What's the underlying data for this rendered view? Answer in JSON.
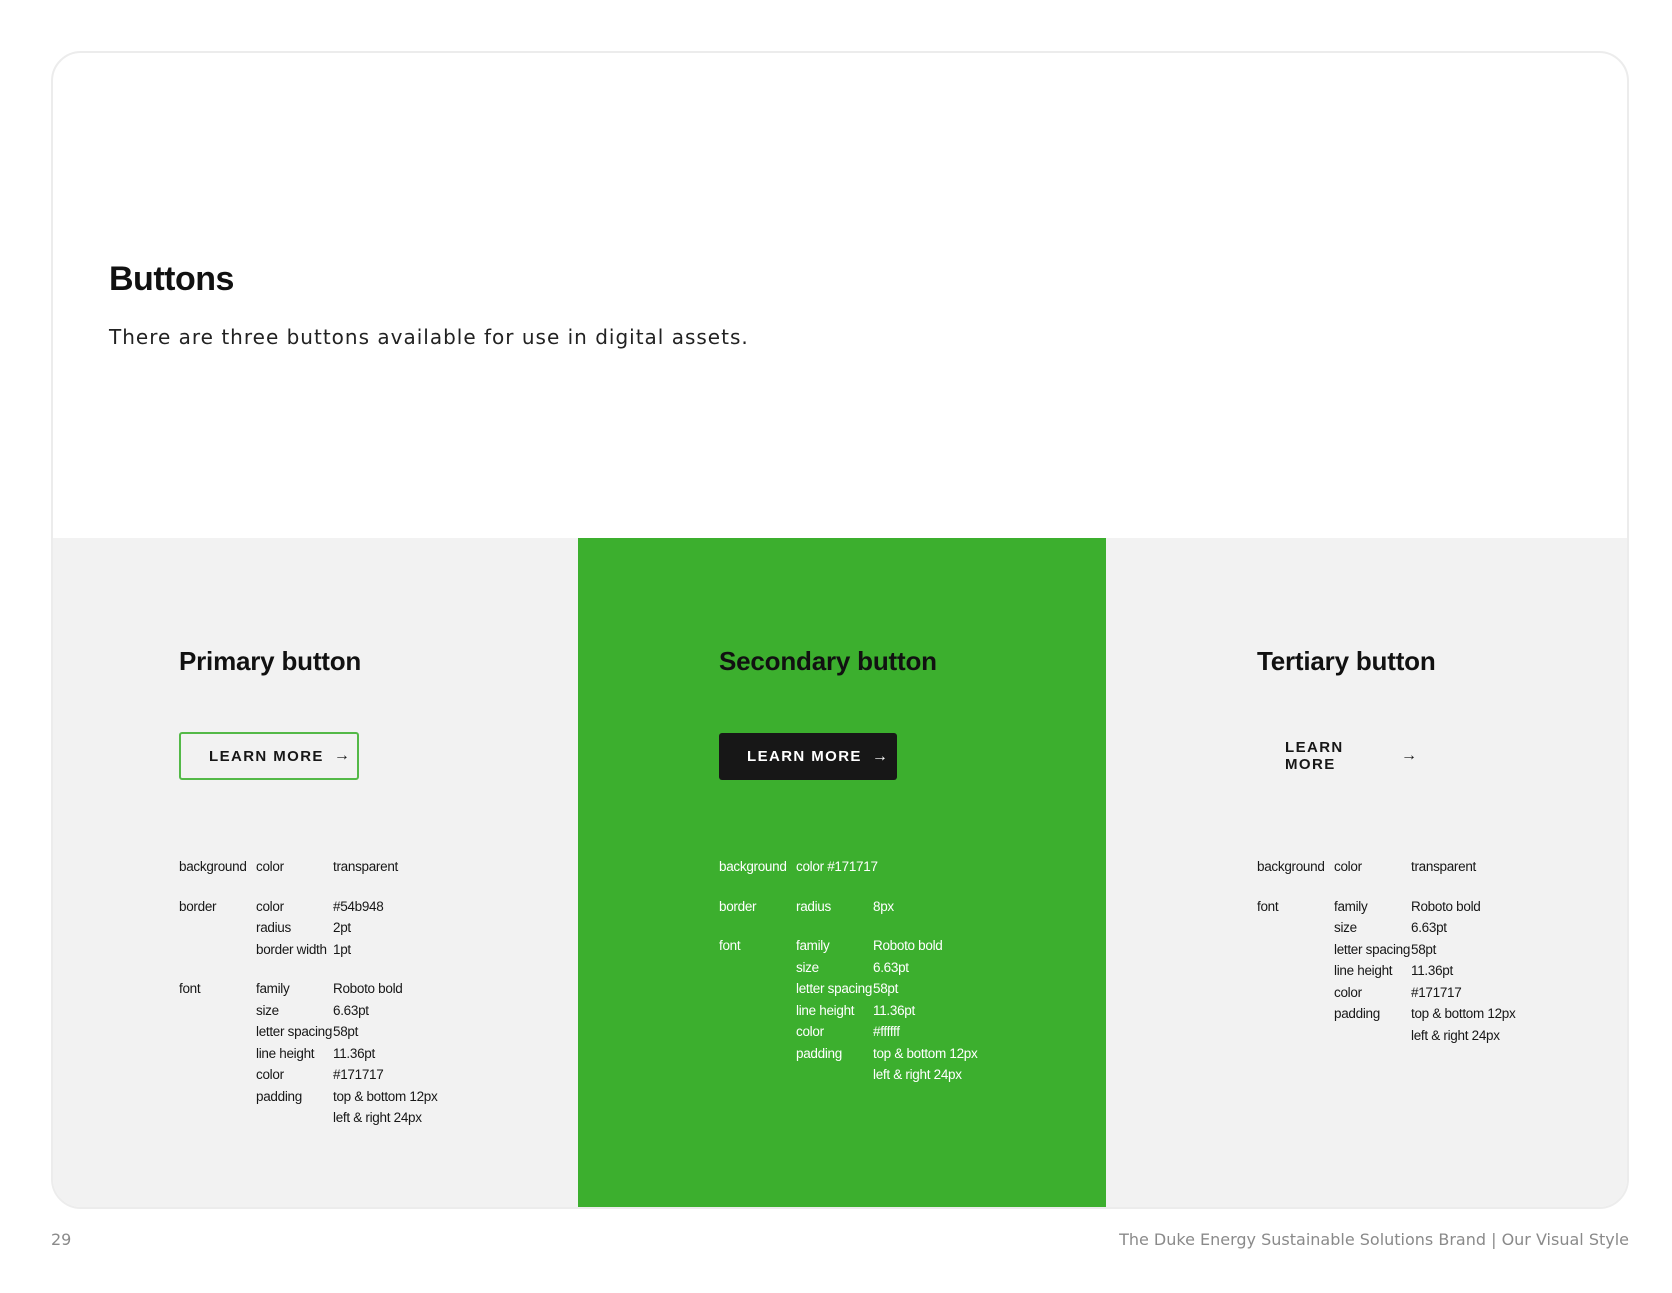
{
  "intro": {
    "title": "Buttons",
    "description": "There are three buttons available for use in digital assets."
  },
  "panels": {
    "primary": {
      "title": "Primary button",
      "button_label": "LEARN MORE",
      "specs": [
        {
          "category": "background",
          "rows": [
            {
              "k": "color",
              "v": "transparent"
            }
          ]
        },
        {
          "category": "border",
          "rows": [
            {
              "k": "color",
              "v": "#54b948"
            },
            {
              "k": "radius",
              "v": "2pt"
            },
            {
              "k": "border width",
              "v": "1pt"
            }
          ]
        },
        {
          "category": "font",
          "rows": [
            {
              "k": "family",
              "v": "Roboto bold"
            },
            {
              "k": "size",
              "v": "6.63pt"
            },
            {
              "k": "letter spacing",
              "v": "58pt"
            },
            {
              "k": "line height",
              "v": "11.36pt"
            },
            {
              "k": "color",
              "v": "#171717"
            },
            {
              "k": "padding",
              "v": "top & bottom 12px"
            },
            {
              "k": "",
              "v": "left & right 24px"
            }
          ]
        }
      ]
    },
    "secondary": {
      "title": "Secondary button",
      "button_label": "LEARN MORE",
      "specs": [
        {
          "category": "background",
          "rows": [
            {
              "k": "color #171717",
              "v": ""
            }
          ]
        },
        {
          "category": "border",
          "rows": [
            {
              "k": "radius",
              "v": "8px"
            }
          ]
        },
        {
          "category": "font",
          "rows": [
            {
              "k": "family",
              "v": "Roboto bold"
            },
            {
              "k": "size",
              "v": "6.63pt"
            },
            {
              "k": "letter spacing",
              "v": "58pt"
            },
            {
              "k": "line height",
              "v": "11.36pt"
            },
            {
              "k": "color",
              "v": "#ffffff"
            },
            {
              "k": "padding",
              "v": "top & bottom 12px"
            },
            {
              "k": "",
              "v": "left & right 24px"
            }
          ]
        }
      ]
    },
    "tertiary": {
      "title": "Tertiary button",
      "button_label": "LEARN MORE",
      "specs": [
        {
          "category": "background",
          "rows": [
            {
              "k": "color",
              "v": "transparent"
            }
          ]
        },
        {
          "category": "font",
          "rows": [
            {
              "k": "family",
              "v": "Roboto bold"
            },
            {
              "k": "size",
              "v": "6.63pt"
            },
            {
              "k": "letter spacing",
              "v": "58pt"
            },
            {
              "k": "line height",
              "v": "11.36pt"
            },
            {
              "k": "color",
              "v": "#171717"
            },
            {
              "k": "padding",
              "v": "top & bottom 12px"
            },
            {
              "k": "",
              "v": "left & right 24px"
            }
          ]
        }
      ]
    }
  },
  "footer": {
    "page_number": "29",
    "doc_title": "The Duke Energy Sustainable Solutions Brand | Our Visual Style"
  },
  "colors": {
    "accent_green": "#3caf2e",
    "border_green": "#54b948",
    "dark": "#171717",
    "panel_gray": "#f2f2f2"
  },
  "icons": {
    "button_arrow": "arrow-right-icon"
  }
}
